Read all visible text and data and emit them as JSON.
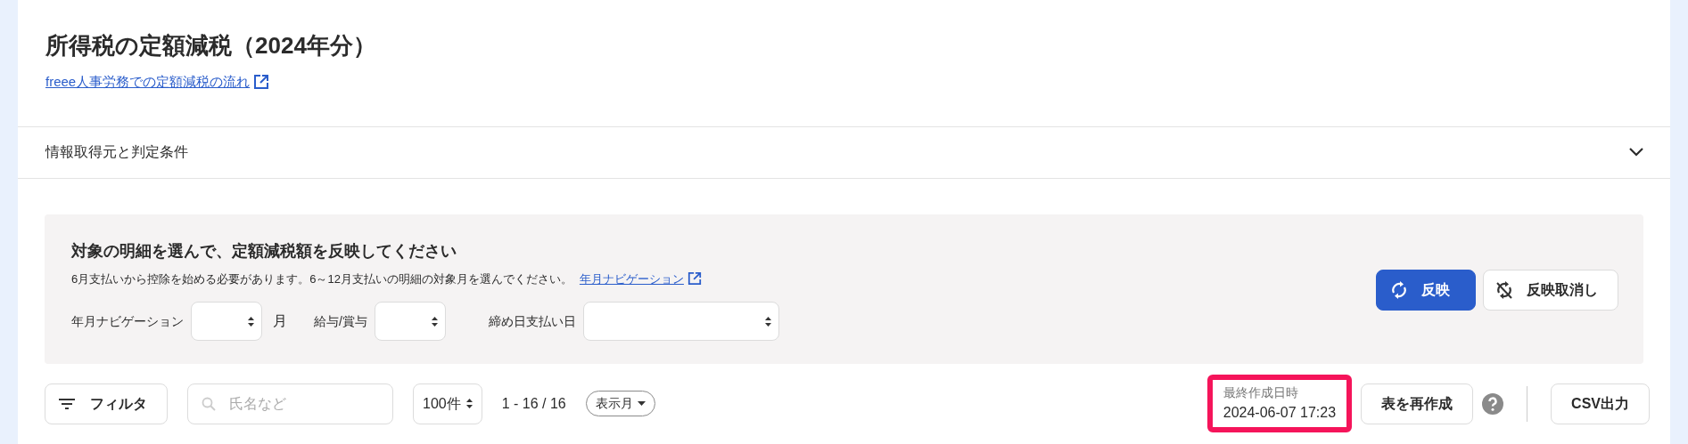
{
  "page": {
    "title": "所得税の定額減税（2024年分）",
    "help_link": "freee人事労務での定額減税の流れ"
  },
  "accordion": {
    "label": "情報取得元と判定条件",
    "expanded": false
  },
  "panel": {
    "title": "対象の明細を選んで、定額減税額を反映してください",
    "description": "6月支払いから控除を始める必要があります。6～12月支払いの明細の対象月を選んでください。",
    "link": "年月ナビゲーション",
    "fields": [
      {
        "label": "年月ナビゲーション",
        "suffix": "月"
      },
      {
        "label": "給与/賞与"
      },
      {
        "label": "締め日支払い日"
      }
    ],
    "buttons": [
      {
        "label": "反映",
        "kind": "primary"
      },
      {
        "label": "反映取消し",
        "kind": "secondary"
      }
    ]
  },
  "toolbar": {
    "filter_button": "フィルタ",
    "search": {
      "placeholder": "氏名など"
    },
    "per_page": "100件",
    "range": "1 - 16 / 16",
    "display_dropdown": "表示月",
    "last_created": {
      "label": "最終作成日時",
      "value": "2024-06-07 17:23",
      "highlighted": true
    },
    "regenerate_button": "表を再作成",
    "export_button": "CSV出力"
  }
}
